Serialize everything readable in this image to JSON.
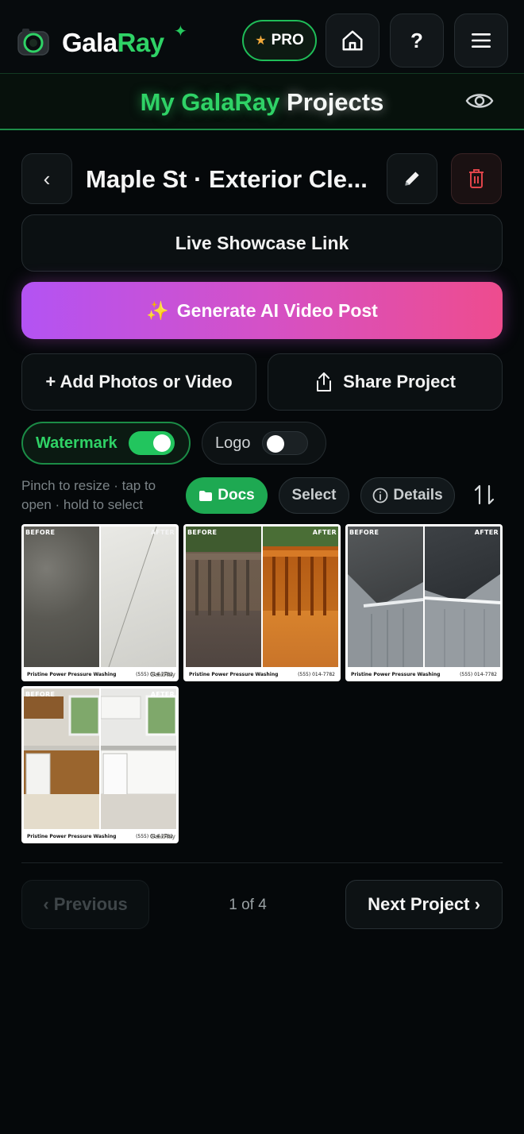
{
  "app": {
    "brand_part1": "Gala",
    "brand_part2": "Ray",
    "pro_label": "PRO"
  },
  "header": {
    "title_part1": "My GalaRay",
    "title_part2": "Projects"
  },
  "project": {
    "name": "Maple St · Exterior Cle...",
    "back_glyph": "‹"
  },
  "actions": {
    "showcase_label": "Live Showcase Link",
    "ai_label": "Generate AI Video Post",
    "add_label": "+ Add Photos or Video",
    "share_label": "Share Project"
  },
  "toggles": {
    "watermark_label": "Watermark",
    "watermark_on": true,
    "logo_label": "Logo",
    "logo_on": false
  },
  "gallery_controls": {
    "hint": "Pinch to resize · tap to open · hold to select",
    "docs_label": "Docs",
    "select_label": "Select",
    "details_label": "Details"
  },
  "tiles": [
    {
      "before": "BEFORE",
      "after": "AFTER",
      "watermark": "GalaRay",
      "company": "Pristine Power Pressure Washing",
      "phone": "(555) 014-7782",
      "subject": "concrete"
    },
    {
      "before": "BEFORE",
      "after": "AFTER",
      "watermark": "GalaRay",
      "company": "Pristine Power Pressure Washing",
      "phone": "(555) 014-7782",
      "subject": "deck"
    },
    {
      "before": "BEFORE",
      "after": "AFTER",
      "watermark": "GalaRay",
      "company": "Pristine Power Pressure Washing",
      "phone": "(555) 014-7782",
      "subject": "roof"
    },
    {
      "before": "BEFORE",
      "after": "AFTER",
      "watermark": "GalaRay",
      "company": "Pristine Power Pressure Washing",
      "phone": "(555) 014-7782",
      "subject": "kitchen"
    }
  ],
  "pagination": {
    "prev_label": "‹ Previous",
    "next_label": "Next Project ›",
    "page_text": "1 of 4"
  },
  "colors": {
    "accent_green": "#2fd266",
    "ai_gradient_start": "#b353f3",
    "ai_gradient_end": "#ee4c8e",
    "pro_star": "#f2a93b",
    "delete_red": "#e0444a"
  }
}
